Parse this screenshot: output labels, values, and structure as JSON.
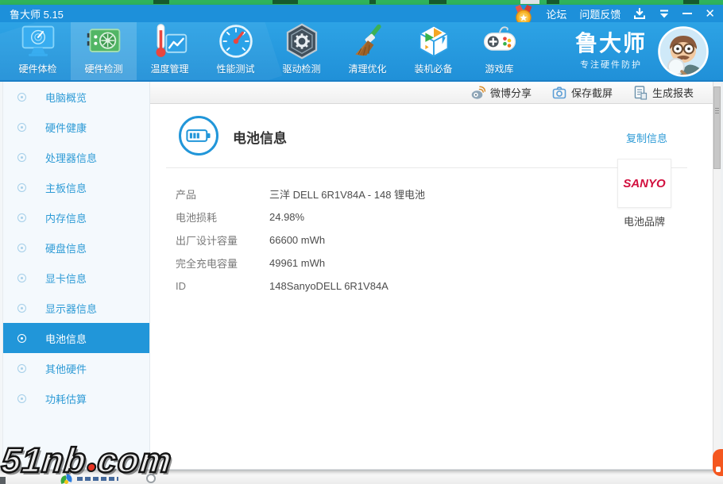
{
  "window": {
    "title": "鲁大师 5.15"
  },
  "titlebar": {
    "forum_label": "论坛",
    "feedback_label": "问题反馈"
  },
  "nav": {
    "items": [
      {
        "label": "硬件体检",
        "icon": "monitor-radar-icon",
        "selected": false
      },
      {
        "label": "硬件检测",
        "icon": "gpu-card-icon",
        "selected": true
      },
      {
        "label": "温度管理",
        "icon": "thermometer-chart-icon",
        "selected": false
      },
      {
        "label": "性能测试",
        "icon": "speedometer-icon",
        "selected": false
      },
      {
        "label": "驱动检测",
        "icon": "gear-hexagon-icon",
        "selected": false
      },
      {
        "label": "清理优化",
        "icon": "broom-icon",
        "selected": false
      },
      {
        "label": "装机必备",
        "icon": "cube-box-icon",
        "selected": false
      },
      {
        "label": "游戏库",
        "icon": "gamepad-icon",
        "selected": false
      }
    ],
    "brand": {
      "name": "鲁大师",
      "slogan": "专注硬件防护"
    }
  },
  "toolbar": {
    "share_label": "微博分享",
    "screenshot_label": "保存截屏",
    "report_label": "生成报表"
  },
  "sidebar": {
    "items": [
      {
        "label": "电脑概览",
        "selected": false
      },
      {
        "label": "硬件健康",
        "selected": false
      },
      {
        "label": "处理器信息",
        "selected": false
      },
      {
        "label": "主板信息",
        "selected": false
      },
      {
        "label": "内存信息",
        "selected": false
      },
      {
        "label": "硬盘信息",
        "selected": false
      },
      {
        "label": "显卡信息",
        "selected": false
      },
      {
        "label": "显示器信息",
        "selected": false
      },
      {
        "label": "电池信息",
        "selected": true
      },
      {
        "label": "其他硬件",
        "selected": false
      },
      {
        "label": "功耗估算",
        "selected": false
      }
    ]
  },
  "main": {
    "title": "电池信息",
    "copy_link": "复制信息",
    "rows": [
      {
        "label": "产品",
        "value": "三洋 DELL 6R1V84A - 148 锂电池"
      },
      {
        "label": "电池损耗",
        "value": "24.98%"
      },
      {
        "label": "出厂设计容量",
        "value": "66600 mWh"
      },
      {
        "label": "完全充电容量",
        "value": "49961 mWh"
      },
      {
        "label": "ID",
        "value": "148SanyoDELL 6R1V84A"
      }
    ],
    "brand_card": {
      "logo": "SANYO",
      "caption": "电池品牌"
    }
  },
  "watermark": {
    "left": "51nb",
    "right": "com"
  },
  "colors": {
    "titlebar_blue": "#1d90da",
    "nav_blue_top": "#2da3e5",
    "nav_blue_bottom": "#2090d8",
    "selected_blue": "#2196d9",
    "sidebar_bg": "#f4f9fd",
    "link_blue": "#2e9bd6",
    "sanyo_red": "#d2103f",
    "green_strip": "#2fb35b",
    "label_gray": "#7a7a7a",
    "value_gray": "#4d4d4d"
  }
}
